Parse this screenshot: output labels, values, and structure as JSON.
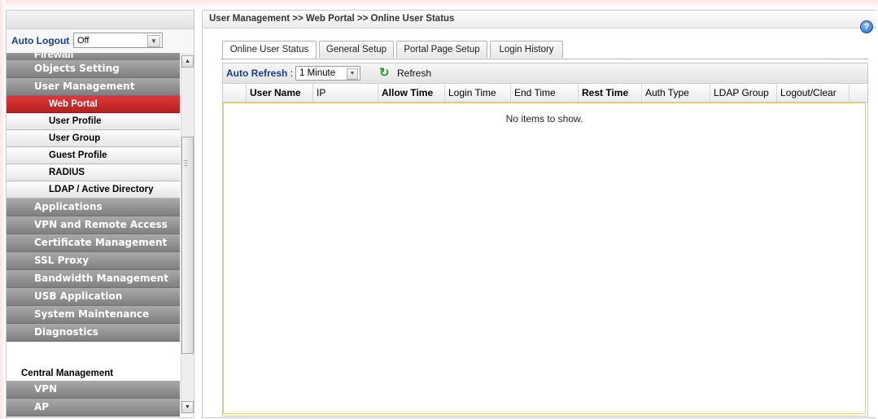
{
  "sidebar": {
    "auto_logout_label": "Auto Logout :",
    "auto_logout_value": "Off",
    "clipped_item": "Firewall",
    "items": [
      {
        "label": "Objects Setting",
        "type": "category"
      },
      {
        "label": "User Management",
        "type": "category"
      },
      {
        "label": "Web Portal",
        "type": "sub",
        "active": true
      },
      {
        "label": "User Profile",
        "type": "sub"
      },
      {
        "label": "User Group",
        "type": "sub"
      },
      {
        "label": "Guest Profile",
        "type": "sub"
      },
      {
        "label": "RADIUS",
        "type": "sub"
      },
      {
        "label": "LDAP / Active Directory",
        "type": "sub"
      },
      {
        "label": "Applications",
        "type": "category"
      },
      {
        "label": "VPN and Remote Access",
        "type": "category"
      },
      {
        "label": "Certificate Management",
        "type": "category"
      },
      {
        "label": "SSL Proxy",
        "type": "category"
      },
      {
        "label": "Bandwidth Management",
        "type": "category"
      },
      {
        "label": "USB Application",
        "type": "category"
      },
      {
        "label": "System Maintenance",
        "type": "category"
      },
      {
        "label": "Diagnostics",
        "type": "category"
      }
    ],
    "central_management_label": "Central Management",
    "central_items": [
      "VPN",
      "AP"
    ]
  },
  "breadcrumb": "User Management >> Web Portal >> Online User Status",
  "help_icon": "?",
  "tabs": [
    {
      "label": "Online User Status",
      "active": true
    },
    {
      "label": "General Setup",
      "active": false
    },
    {
      "label": "Portal Page Setup",
      "active": false
    },
    {
      "label": "Login History",
      "active": false
    }
  ],
  "toolbar": {
    "auto_refresh_label": "Auto Refresh",
    "auto_refresh_colon": ":",
    "auto_refresh_value": "1 Minute",
    "refresh_label": "Refresh"
  },
  "table": {
    "columns": [
      "User Name",
      "IP",
      "Allow Time",
      "Login Time",
      "End Time",
      "Rest Time",
      "Auth Type",
      "LDAP Group",
      "Logout/Clear"
    ],
    "bold_columns": [
      "User Name",
      "Allow Time",
      "Rest Time"
    ],
    "empty_message": "No items to show."
  },
  "colors": {
    "active_menu": "#c62828",
    "category_menu": "#8c8c8c",
    "label_blue": "#1a3e88",
    "refresh_icon": "#2a9a3a"
  }
}
